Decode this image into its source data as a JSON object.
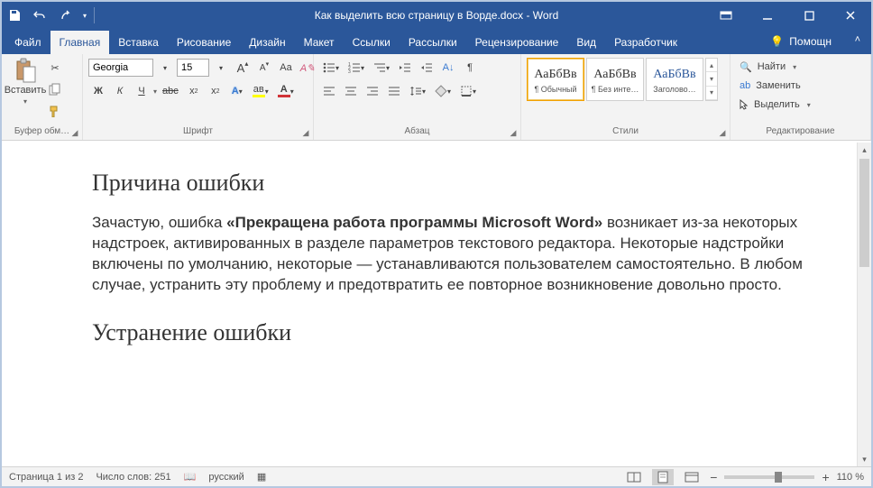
{
  "titlebar": {
    "doc_title": "Как выделить всю страницу в Ворде.docx  -  Word"
  },
  "tabs": {
    "file": "Файл",
    "home": "Главная",
    "insert": "Вставка",
    "draw": "Рисование",
    "design": "Дизайн",
    "layout": "Макет",
    "references": "Ссылки",
    "mailings": "Рассылки",
    "review": "Рецензирование",
    "view": "Вид",
    "developer": "Разработчик",
    "tell_me": "Помощн"
  },
  "ribbon": {
    "clipboard": {
      "label": "Буфер обм…",
      "paste": "Вставить"
    },
    "font": {
      "label": "Шрифт",
      "name": "Georgia",
      "size": "15",
      "bold": "Ж",
      "italic": "К",
      "underline": "Ч",
      "strike": "abc",
      "sub": "x₂",
      "sup": "x²",
      "text_effects": "A",
      "highlight": "aʙ",
      "font_color": "A",
      "grow": "A",
      "shrink": "A",
      "change_case": "Aa",
      "clear": "✐"
    },
    "paragraph": {
      "label": "Абзац"
    },
    "styles": {
      "label": "Стили",
      "s1_preview": "АаБбВв",
      "s1_name": "¶ Обычный",
      "s2_preview": "АаБбВв",
      "s2_name": "¶ Без инте…",
      "s3_preview": "АаБбВв",
      "s3_name": "Заголово…"
    },
    "editing": {
      "label": "Редактирование",
      "find": "Найти",
      "replace": "Заменить",
      "select": "Выделить"
    }
  },
  "document": {
    "h1": "Причина ошибки",
    "p1_a": "Зачастую, ошибка ",
    "p1_b": "«Прекращена работа программы Microsoft Word»",
    "p1_c": " возникает из-за некоторых надстроек, активированных в разделе параметров текстового редактора. Некоторые надстройки включены по умолчанию, некоторые — устанавливаются пользователем самостоятельно. В любом случае, устранить эту проблему и предотвратить ее повторное возникновение довольно просто.",
    "h2": "Устранение ошибки"
  },
  "status": {
    "page": "Страница 1 из 2",
    "words": "Число слов: 251",
    "lang": "русский",
    "zoom": "110 %"
  }
}
